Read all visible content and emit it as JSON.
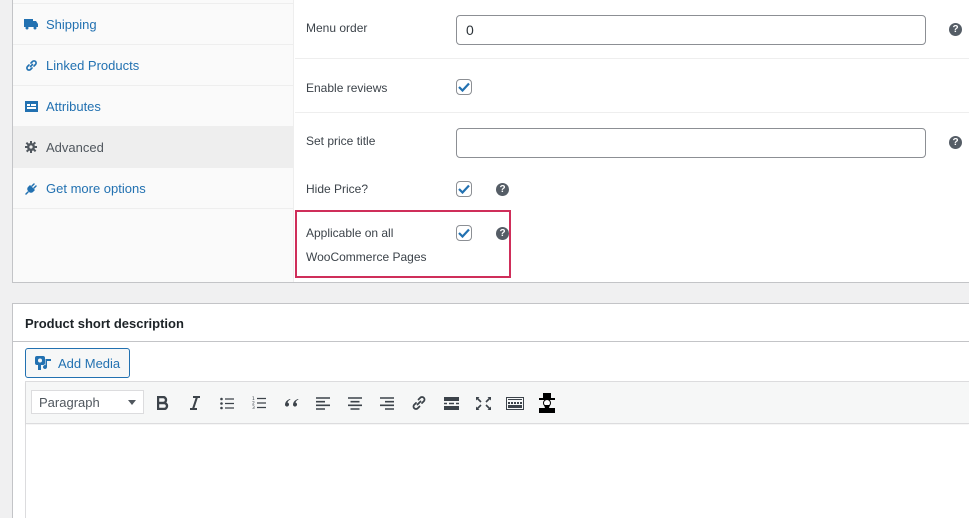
{
  "product_data": {
    "tabs": [
      {
        "label": "Shipping",
        "icon": "truck-icon",
        "active": false
      },
      {
        "label": "Linked Products",
        "icon": "link-icon",
        "active": false
      },
      {
        "label": "Attributes",
        "icon": "list-card-icon",
        "active": false
      },
      {
        "label": "Advanced",
        "icon": "gear-icon",
        "active": true
      },
      {
        "label": "Get more options",
        "icon": "plugin-icon",
        "active": false
      }
    ],
    "fields": {
      "menu_order": {
        "label": "Menu order",
        "value": "0"
      },
      "enable_reviews": {
        "label": "Enable reviews",
        "checked": true
      },
      "set_price_title": {
        "label": "Set price title",
        "value": ""
      },
      "hide_price": {
        "label": "Hide Price?",
        "checked": true
      },
      "applicable_all": {
        "label_line1": "Applicable on all",
        "label_line2": "WooCommerce Pages",
        "checked": true
      }
    },
    "help_glyph": "?"
  },
  "short_description": {
    "title": "Product short description",
    "add_media_label": "Add Media",
    "format_select": {
      "selected": "Paragraph"
    },
    "toolbar_buttons": [
      "bold",
      "italic",
      "bulleted-list",
      "numbered-list",
      "blockquote",
      "align-left",
      "align-center",
      "align-right",
      "insert-link",
      "read-more",
      "fullscreen",
      "toolbar-toggle",
      "custom-plugin"
    ]
  },
  "colors": {
    "link": "#2271b1",
    "highlight_border": "#cf2e5a",
    "checkmark": "#2271b1",
    "help_icon": "#555d66"
  }
}
